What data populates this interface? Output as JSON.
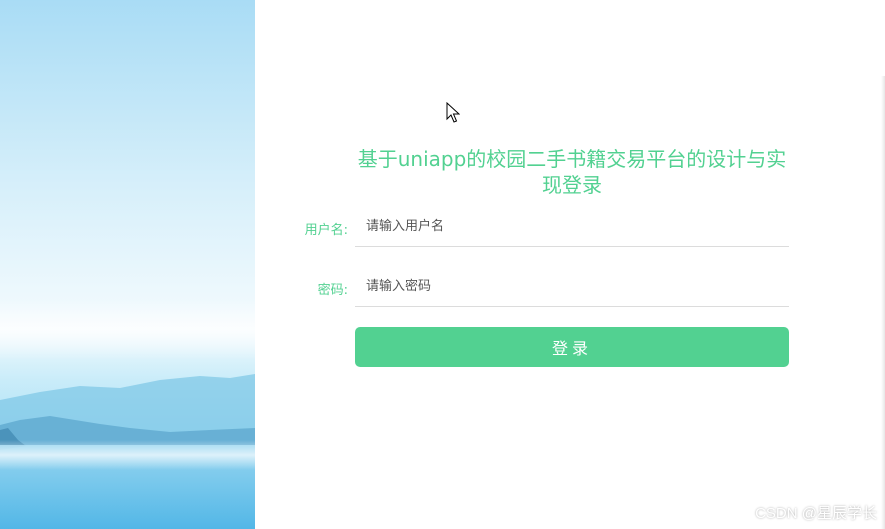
{
  "login": {
    "title": "基于uniapp的校园二手书籍交易平台的设计与实现登录",
    "username_label": "用户名:",
    "username_placeholder": "请输入用户名",
    "username_value": "",
    "password_label": "密码:",
    "password_placeholder": "请输入密码",
    "password_value": "",
    "submit_label": "登录"
  },
  "background": {
    "description_icon": "misty-mountains-sky-image"
  },
  "watermark": {
    "text": "CSDN @星辰学长"
  },
  "colors": {
    "accent": "#52d191",
    "text_muted": "#555555",
    "divider": "#dcdcdc"
  },
  "icons": {
    "cursor": "mouse-pointer-icon"
  }
}
